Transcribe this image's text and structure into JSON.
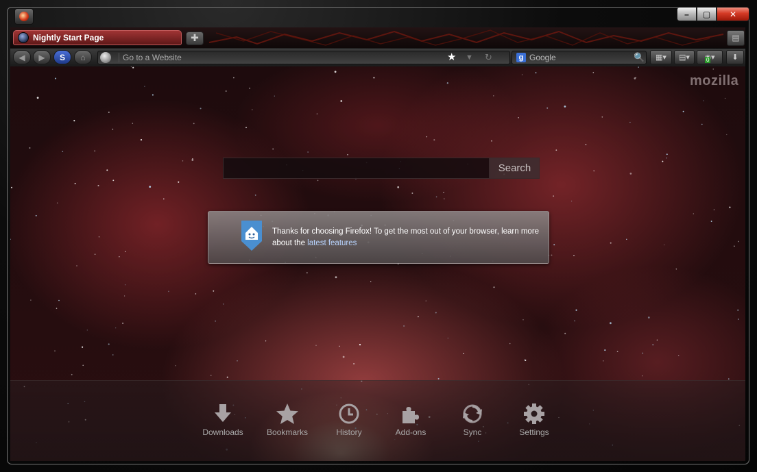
{
  "window": {
    "tab_title": "Nightly Start Page"
  },
  "navbar": {
    "url_placeholder": "Go to a Website",
    "search_engine": "Google",
    "search_placeholder": "Google",
    "notification_count": "0"
  },
  "page": {
    "brand": "mozilla",
    "search_button": "Search",
    "snippet": {
      "text": "Thanks for choosing Firefox! To get the most out of your browser, learn more about the ",
      "link": "latest features"
    },
    "launcher": [
      {
        "id": "downloads",
        "label": "Downloads",
        "icon": "download-icon"
      },
      {
        "id": "bookmarks",
        "label": "Bookmarks",
        "icon": "star-icon"
      },
      {
        "id": "history",
        "label": "History",
        "icon": "clock-icon"
      },
      {
        "id": "addons",
        "label": "Add-ons",
        "icon": "puzzle-icon"
      },
      {
        "id": "sync",
        "label": "Sync",
        "icon": "sync-icon"
      },
      {
        "id": "settings",
        "label": "Settings",
        "icon": "gear-icon"
      }
    ]
  },
  "colors": {
    "tab_active": "#a03434",
    "close_button": "#d43a25",
    "link": "#b8d4ff"
  }
}
